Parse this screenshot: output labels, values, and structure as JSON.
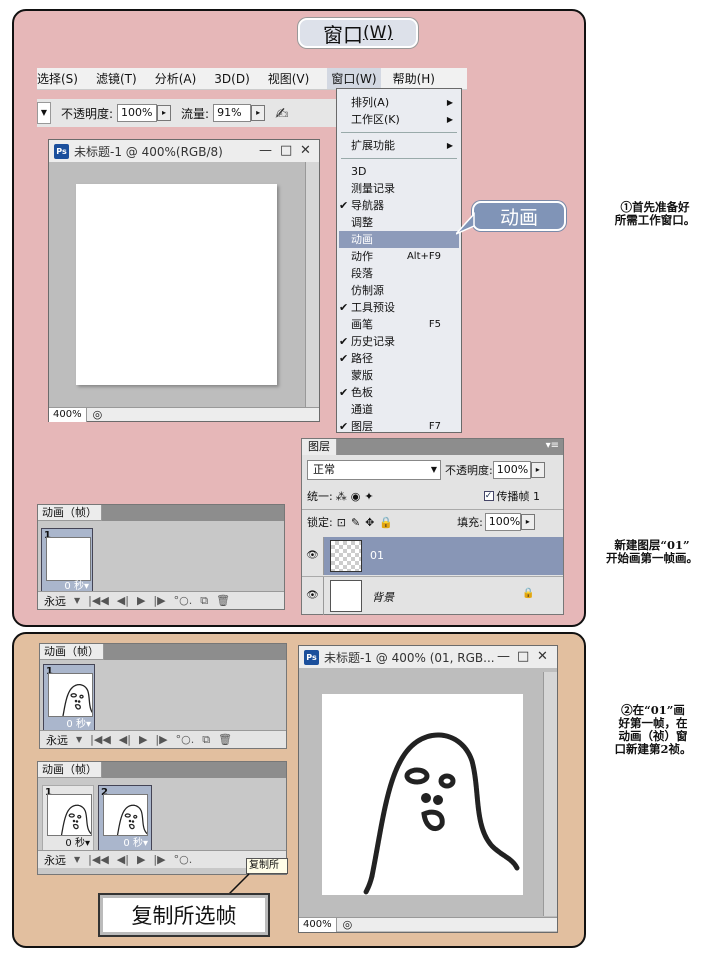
{
  "callouts": {
    "window_menu": "窗口",
    "window_menu_key": "(W)",
    "animation": "动画",
    "duplicate_frame": "复制所选帧",
    "duplicate_tip": "复制所"
  },
  "captions": {
    "step1": [
      "①首先准备好",
      "所需工作窗口。"
    ],
    "new_layer": [
      "新建图层“01”",
      "开始画第一帧画。"
    ],
    "step2": [
      "②在“01”画",
      "好第一帧，在",
      "动画（祯）窗",
      "口新建第2祯。"
    ]
  },
  "menubar": [
    "选择(S)",
    "滤镜(T)",
    "分析(A)",
    "3D(D)",
    "视图(V)",
    "窗口(W)",
    "帮助(H)"
  ],
  "options_bar": {
    "opacity_label": "不透明度:",
    "opacity_value": "100%",
    "flow_label": "流量:",
    "flow_value": "91%"
  },
  "window_menu": {
    "group1": [
      {
        "label": "排列(A)"
      },
      {
        "label": "工作区(K)"
      }
    ],
    "group2": [
      {
        "label": "扩展功能"
      }
    ],
    "group3": [
      {
        "label": "3D",
        "checked": false,
        "shortcut": ""
      },
      {
        "label": "测量记录",
        "checked": false,
        "shortcut": ""
      },
      {
        "label": "导航器",
        "checked": true,
        "shortcut": ""
      },
      {
        "label": "调整",
        "checked": false,
        "shortcut": ""
      },
      {
        "label": "动画",
        "checked": false,
        "shortcut": "",
        "highlighted": true
      },
      {
        "label": "动作",
        "checked": false,
        "shortcut": "Alt+F9"
      },
      {
        "label": "段落",
        "checked": false,
        "shortcut": ""
      },
      {
        "label": "仿制源",
        "checked": false,
        "shortcut": ""
      },
      {
        "label": "工具预设",
        "checked": true,
        "shortcut": ""
      },
      {
        "label": "画笔",
        "checked": false,
        "shortcut": "F5"
      },
      {
        "label": "历史记录",
        "checked": true,
        "shortcut": ""
      },
      {
        "label": "路径",
        "checked": true,
        "shortcut": ""
      },
      {
        "label": "蒙版",
        "checked": false,
        "shortcut": ""
      },
      {
        "label": "色板",
        "checked": true,
        "shortcut": ""
      },
      {
        "label": "通道",
        "checked": false,
        "shortcut": ""
      },
      {
        "label": "图层",
        "checked": true,
        "shortcut": "F7"
      }
    ]
  },
  "doc_window_1": {
    "app_icon": "Ps",
    "title": "未标题-1 @ 400%(RGB/8)",
    "zoom": "400%"
  },
  "doc_window_2": {
    "app_icon": "Ps",
    "title": "未标题-1 @ 400% (01, RGB...",
    "zoom": "400%"
  },
  "layers_panel": {
    "tab": "图层",
    "blend_mode": "正常",
    "opacity_label": "不透明度:",
    "opacity_value": "100%",
    "unify_label": "统一:",
    "propagate_label": "传播帧 1",
    "lock_label": "锁定:",
    "fill_label": "填充:",
    "fill_value": "100%",
    "layers": [
      {
        "name": "01",
        "visible": true,
        "selected": true
      },
      {
        "name": "背景",
        "visible": true,
        "selected": false,
        "locked": true
      }
    ]
  },
  "animation_panel": {
    "tab": "动画（帧）",
    "loop": "永远",
    "frame_delay": "0 秒",
    "frames_1": [
      "1"
    ],
    "frames_2": [
      "1",
      "2"
    ]
  },
  "colors": {
    "panel_top": "#e6b7b8",
    "panel_bottom": "#e2bf9f",
    "menu_highlight": "#8d9bba"
  }
}
